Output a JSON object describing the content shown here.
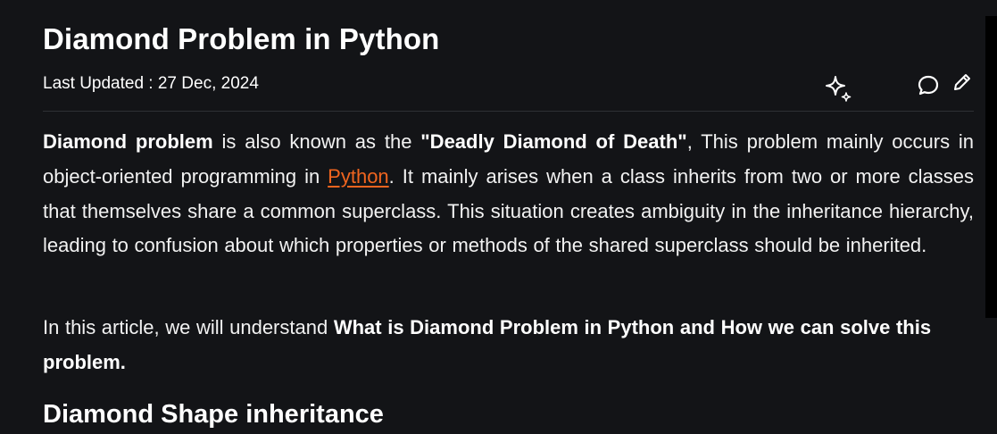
{
  "article": {
    "title": "Diamond Problem in Python",
    "last_updated": "Last Updated : 27 Dec, 2024",
    "paragraph1": {
      "bold1": "Diamond problem",
      "text1": " is also known as the ",
      "bold2": "\"Deadly Diamond of Death\"",
      "text2": ", This problem mainly occurs in object-oriented programming in ",
      "link": "Python",
      "text3": ". It mainly arises when a class inherits from two or more classes that themselves share a common superclass. This situation creates ambiguity in the inheritance hierarchy, leading to confusion about which properties or methods of the shared superclass should be inherited."
    },
    "paragraph2": {
      "text1": "In this article, we will understand ",
      "bold1": "What is Diamond Problem in Python and How we can solve this problem."
    },
    "subheading": "Diamond Shape inheritance"
  },
  "actions": {
    "icons": [
      "ai-sparkle-icon",
      "comment-icon",
      "edit-pencil-icon",
      "more-vertical-icon"
    ]
  },
  "colors": {
    "background": "#131417",
    "text": "#f2f2f2",
    "link": "#f0651f",
    "divider": "#2e3035"
  }
}
